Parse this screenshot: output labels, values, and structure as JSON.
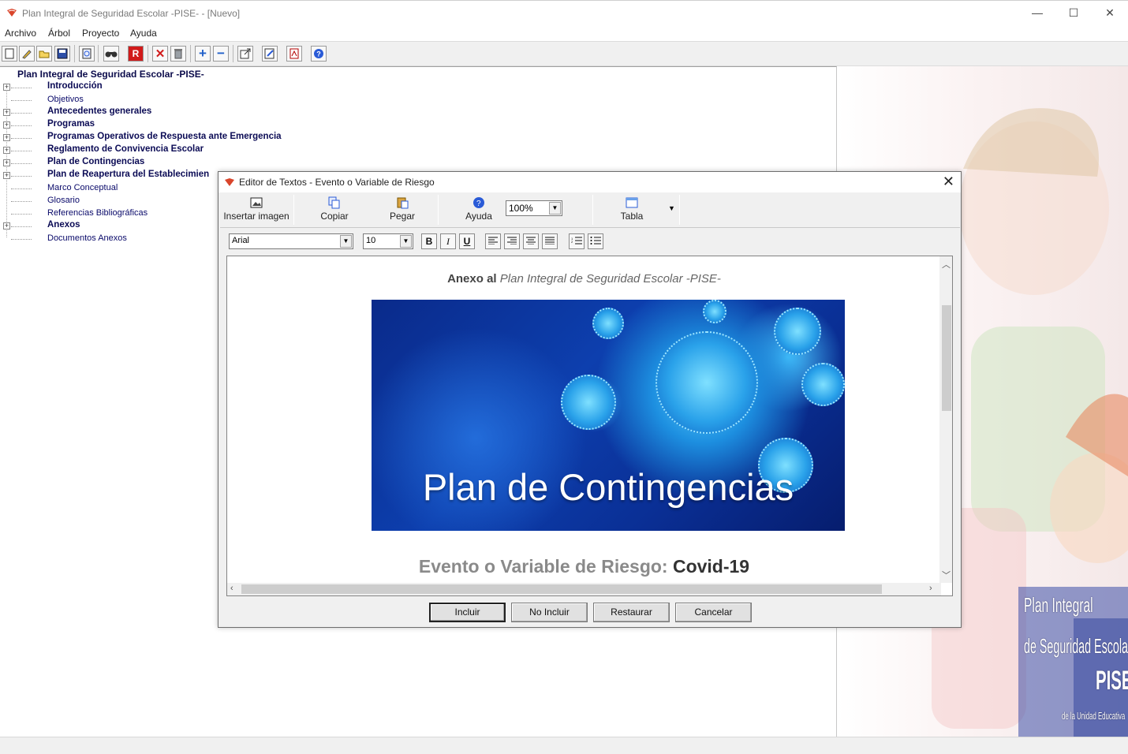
{
  "window": {
    "title": "Plan Integral de Seguridad Escolar -PISE- - [Nuevo]",
    "minimize": "—",
    "maximize": "☐",
    "close": "✕"
  },
  "menu": [
    "Archivo",
    "Árbol",
    "Proyecto",
    "Ayuda"
  ],
  "toolbar_icons": [
    "new-icon",
    "edit-icon",
    "open-icon",
    "save-icon",
    "preview-icon",
    "find-icon",
    "report-icon",
    "delete-icon",
    "trash-icon",
    "add-icon",
    "remove-icon",
    "export-icon",
    "edit-doc-icon",
    "pdf-icon",
    "help-icon"
  ],
  "tree": {
    "root": "Plan Integral de Seguridad Escolar -PISE-",
    "items": [
      {
        "label": "Introducción",
        "bold": true,
        "expandable": true
      },
      {
        "label": "Objetivos",
        "bold": false,
        "expandable": false
      },
      {
        "label": "Antecedentes generales",
        "bold": true,
        "expandable": true
      },
      {
        "label": "Programas",
        "bold": true,
        "expandable": true
      },
      {
        "label": "Programas Operativos de Respuesta ante Emergencia",
        "bold": true,
        "expandable": true
      },
      {
        "label": "Reglamento de Convivencia Escolar",
        "bold": true,
        "expandable": true
      },
      {
        "label": "Plan de Contingencias",
        "bold": true,
        "expandable": true
      },
      {
        "label": "Plan de Reapertura del Establecimien",
        "bold": true,
        "expandable": true
      },
      {
        "label": "Marco Conceptual",
        "bold": false,
        "expandable": false
      },
      {
        "label": "Glosario",
        "bold": false,
        "expandable": false
      },
      {
        "label": "Referencias Bibliográficas",
        "bold": false,
        "expandable": false
      },
      {
        "label": "Anexos",
        "bold": true,
        "expandable": true
      },
      {
        "label": "Documentos Anexos",
        "bold": false,
        "expandable": false
      }
    ]
  },
  "deco": {
    "line1": "Plan Integral",
    "line2": "de Seguridad Escolar",
    "line3": "PISE",
    "line4": "de la Unidad Educativa"
  },
  "dialog": {
    "title": "Editor de Textos - Evento o Variable de Riesgo",
    "toolbar": {
      "insert_image": "Insertar imagen",
      "copy": "Copiar",
      "paste": "Pegar",
      "help": "Ayuda",
      "zoom": "100%",
      "table": "Tabla"
    },
    "format": {
      "font": "Arial",
      "size": "10",
      "bold": "B",
      "italic": "I",
      "underline": "U"
    },
    "doc": {
      "head_bold": "Anexo al",
      "head_italic": "Plan Integral de Seguridad Escolar -PISE-",
      "banner_text": "Plan de Contingencias",
      "sub_label": "Evento o Variable de Riesgo:",
      "sub_value": "Covid-19"
    },
    "buttons": {
      "include": "Incluir",
      "not_include": "No Incluir",
      "restore": "Restaurar",
      "cancel": "Cancelar"
    }
  },
  "colors": {
    "tree_text": "#0a0a6a",
    "banner_blue": "#0d3fae"
  }
}
